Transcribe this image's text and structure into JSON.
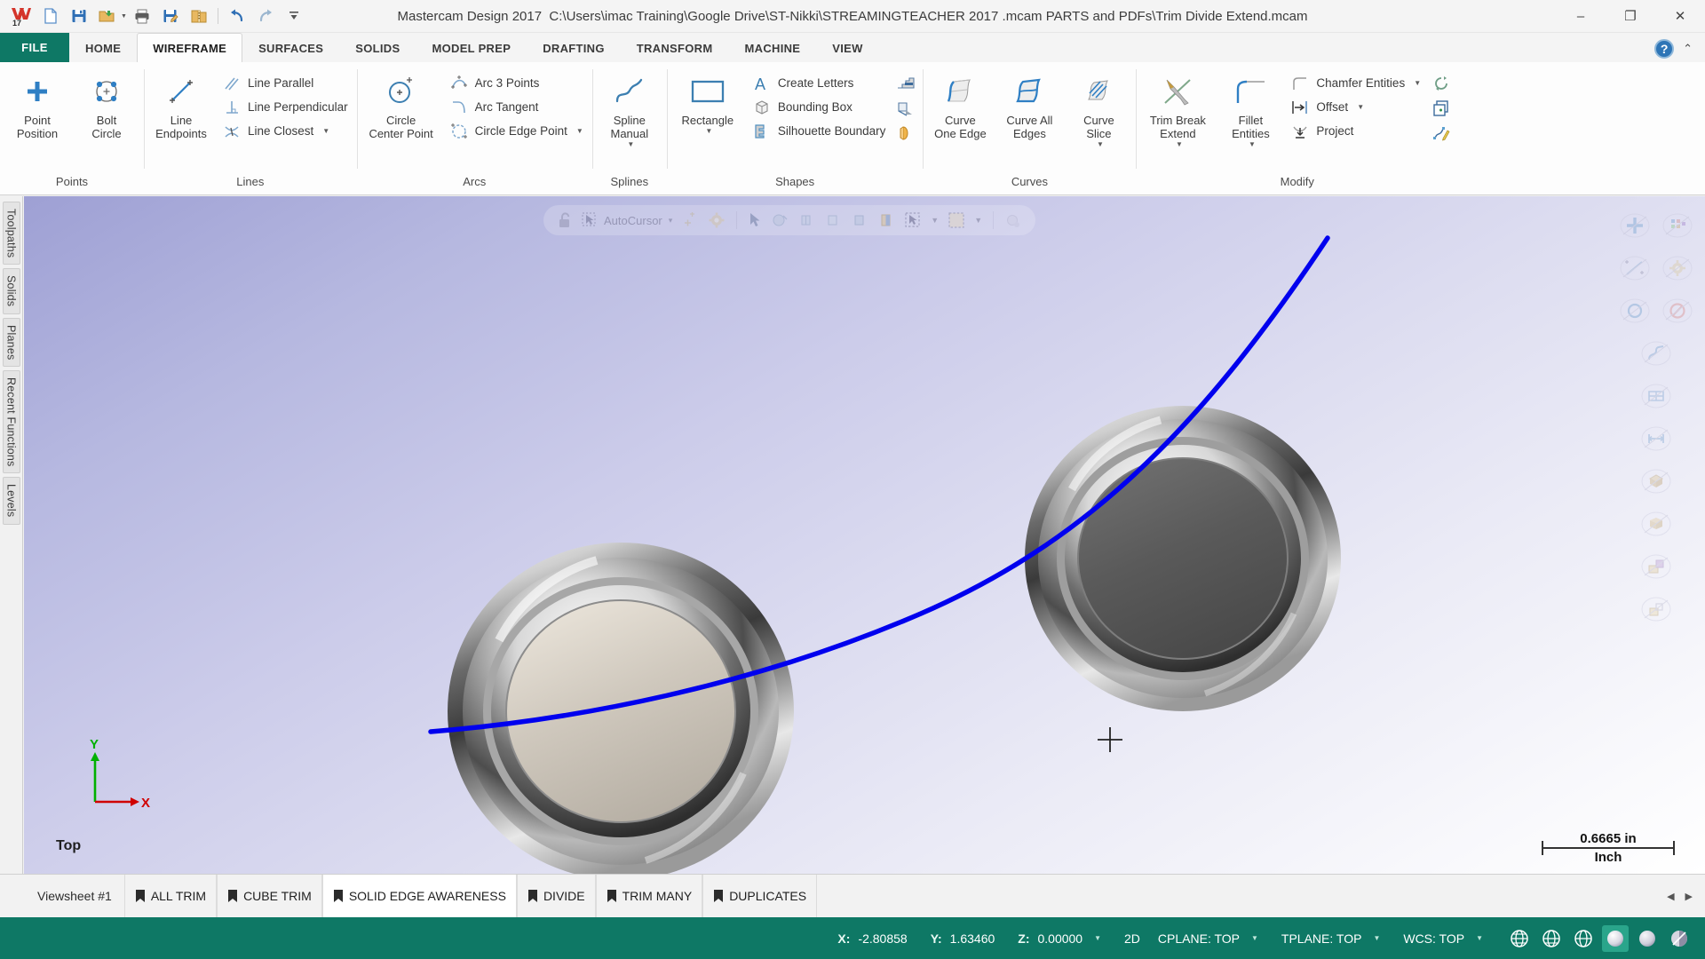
{
  "window": {
    "app_title": "Mastercam Design 2017",
    "file_path": "C:\\Users\\imac Training\\Google Drive\\ST-Nikki\\STREAMINGTEACHER 2017 .mcam PARTS and PDFs\\Trim Divide Extend.mcam",
    "minimize": "–",
    "restore": "❐",
    "close": "✕",
    "help": "?",
    "collapse_ribbon": "⌃"
  },
  "quick_access": [
    {
      "name": "new-file-icon",
      "label": "New"
    },
    {
      "name": "save-icon",
      "label": "Save"
    },
    {
      "name": "open-folder-icon",
      "label": "Open"
    },
    {
      "name": "print-icon",
      "label": "Print"
    },
    {
      "name": "save-as-icon",
      "label": "Save As"
    },
    {
      "name": "zip2go-icon",
      "label": "Zip2Go"
    },
    {
      "name": "undo-icon",
      "label": "Undo"
    },
    {
      "name": "redo-icon",
      "label": "Redo"
    },
    {
      "name": "customize-qat-icon",
      "label": "Customize Quick Access Toolbar"
    }
  ],
  "ribbon": {
    "file_tab": "FILE",
    "tabs": [
      {
        "label": "HOME",
        "active": false
      },
      {
        "label": "WIREFRAME",
        "active": true
      },
      {
        "label": "SURFACES",
        "active": false
      },
      {
        "label": "SOLIDS",
        "active": false
      },
      {
        "label": "MODEL PREP",
        "active": false
      },
      {
        "label": "DRAFTING",
        "active": false
      },
      {
        "label": "TRANSFORM",
        "active": false
      },
      {
        "label": "MACHINE",
        "active": false
      },
      {
        "label": "VIEW",
        "active": false
      }
    ],
    "groups": [
      {
        "name": "points",
        "label": "Points",
        "big": [
          {
            "label": "Point\nPosition",
            "icon": "point-position-icon",
            "caret": true
          },
          {
            "label": "Bolt\nCircle",
            "icon": "bolt-circle-icon",
            "caret": false
          }
        ],
        "small": []
      },
      {
        "name": "lines",
        "label": "Lines",
        "big": [
          {
            "label": "Line\nEndpoints",
            "icon": "line-endpoints-icon",
            "caret": false
          }
        ],
        "small": [
          {
            "label": "Line Parallel",
            "icon": "line-parallel-icon",
            "caret": false
          },
          {
            "label": "Line Perpendicular",
            "icon": "line-perpendicular-icon",
            "caret": false
          },
          {
            "label": "Line Closest",
            "icon": "line-closest-icon",
            "caret": true
          }
        ]
      },
      {
        "name": "arcs",
        "label": "Arcs",
        "big": [
          {
            "label": "Circle\nCenter Point",
            "icon": "circle-center-point-icon",
            "caret": false
          }
        ],
        "small": [
          {
            "label": "Arc 3 Points",
            "icon": "arc-3-points-icon",
            "caret": false
          },
          {
            "label": "Arc Tangent",
            "icon": "arc-tangent-icon",
            "caret": false
          },
          {
            "label": "Circle Edge Point",
            "icon": "circle-edge-point-icon",
            "caret": true
          }
        ]
      },
      {
        "name": "splines",
        "label": "Splines",
        "big": [
          {
            "label": "Spline\nManual",
            "icon": "spline-manual-icon",
            "caret": true
          }
        ],
        "small": []
      },
      {
        "name": "shapes",
        "label": "Shapes",
        "big": [
          {
            "label": "Rectangle",
            "icon": "rectangle-icon",
            "caret": true
          }
        ],
        "small": [
          {
            "label": "Create Letters",
            "icon": "create-letters-icon",
            "caret": false
          },
          {
            "label": "Bounding Box",
            "icon": "bounding-box-icon",
            "caret": false
          },
          {
            "label": "Silhouette Boundary",
            "icon": "silhouette-boundary-icon",
            "caret": false
          }
        ],
        "icons": [
          {
            "name": "stairs-shape-icon"
          },
          {
            "name": "door-shape-icon"
          },
          {
            "name": "relief-shape-icon"
          }
        ]
      },
      {
        "name": "curves",
        "label": "Curves",
        "big": [
          {
            "label": "Curve\nOne Edge",
            "icon": "curve-one-edge-icon",
            "caret": false
          },
          {
            "label": "Curve All\nEdges",
            "icon": "curve-all-edges-icon",
            "caret": false
          },
          {
            "label": "Curve\nSlice",
            "icon": "curve-slice-icon",
            "caret": true
          }
        ],
        "small": []
      },
      {
        "name": "modify",
        "label": "Modify",
        "big": [
          {
            "label": "Trim Break\nExtend",
            "icon": "trim-break-extend-icon",
            "caret": true
          },
          {
            "label": "Fillet\nEntities",
            "icon": "fillet-entities-icon",
            "caret": true
          }
        ],
        "small": [
          {
            "label": "Chamfer Entities",
            "icon": "chamfer-entities-icon",
            "caret": true
          },
          {
            "label": "Offset",
            "icon": "offset-icon",
            "caret": true
          },
          {
            "label": "Project",
            "icon": "project-icon",
            "caret": false
          }
        ],
        "icons": [
          {
            "name": "convert-nurbs-icon",
            "caret": true
          },
          {
            "name": "add-to-level-icon",
            "caret": false
          },
          {
            "name": "modify-spline-icon",
            "caret": true
          }
        ]
      }
    ]
  },
  "left_rail": [
    {
      "label": "Toolpaths"
    },
    {
      "label": "Solids"
    },
    {
      "label": "Planes"
    },
    {
      "label": "Recent Functions"
    },
    {
      "label": "Levels"
    }
  ],
  "viewport": {
    "autocursor": {
      "lock_icon": "unlock-icon",
      "label": "AutoCursor",
      "caret": "▾",
      "icons": [
        "autocursor-pick-icon",
        "autocursor-point-icon",
        "autocursor-settings-icon",
        "select-arrow-icon",
        "select-wireframe-icon",
        "select-face-icon",
        "select-solid-icon",
        "select-body-icon",
        "select-plane-icon",
        "select-window-icon",
        "selection-mask-icon",
        "end-selection-icon"
      ]
    },
    "quick_masks": [
      "mask-points-icon",
      "mask-all-entities-icon",
      "mask-lines-icon",
      "mask-settings-icon",
      "mask-arcs-icon",
      "mask-none-icon",
      "mask-splines-icon",
      "mask-surfaces-icon",
      "mask-dimensions-icon",
      "mask-solids-icon",
      "mask-solid-faces-icon",
      "mask-groups-icon",
      "mask-color-icon",
      "mask-level-icon"
    ],
    "gnomon": {
      "x_label": "X",
      "y_label": "Y"
    },
    "view_name": "Top",
    "scale": {
      "value": "0.6665 in",
      "unit": "Inch"
    },
    "cursor": {
      "glyph": "crosshair"
    }
  },
  "sheetbar": {
    "label": "Viewsheet #1",
    "tabs": [
      {
        "label": "ALL TRIM",
        "active": false
      },
      {
        "label": "CUBE TRIM",
        "active": false
      },
      {
        "label": "SOLID EDGE AWARENESS",
        "active": true
      },
      {
        "label": "DIVIDE",
        "active": false
      },
      {
        "label": "TRIM MANY",
        "active": false
      },
      {
        "label": "DUPLICATES",
        "active": false
      }
    ],
    "nav": {
      "prev": "◀",
      "next": "▶"
    }
  },
  "statusbar": {
    "coords": [
      {
        "key": "X:",
        "value": "-2.80858"
      },
      {
        "key": "Y:",
        "value": "1.63460"
      },
      {
        "key": "Z:",
        "value": "0.00000",
        "caret": true
      }
    ],
    "mode": "2D",
    "planes": [
      {
        "label": "CPLANE: TOP",
        "caret": true
      },
      {
        "label": "TPLANE: TOP",
        "caret": true
      },
      {
        "label": "WCS: TOP",
        "caret": true
      }
    ],
    "icons": [
      {
        "name": "wireframe-shading-icon",
        "active": false
      },
      {
        "name": "hidden-lines-icon",
        "active": false
      },
      {
        "name": "shaded-edges-icon",
        "active": false
      },
      {
        "name": "shaded-solid-icon",
        "active": true
      },
      {
        "name": "material-shading-icon",
        "active": false
      },
      {
        "name": "translucent-icon",
        "active": false
      }
    ]
  },
  "colors": {
    "accent_green": "#0e7865",
    "ribbon_blue": "#2e75b6",
    "spline_blue": "#0000ee",
    "axis_x": "#d00000",
    "axis_y": "#00b000"
  }
}
